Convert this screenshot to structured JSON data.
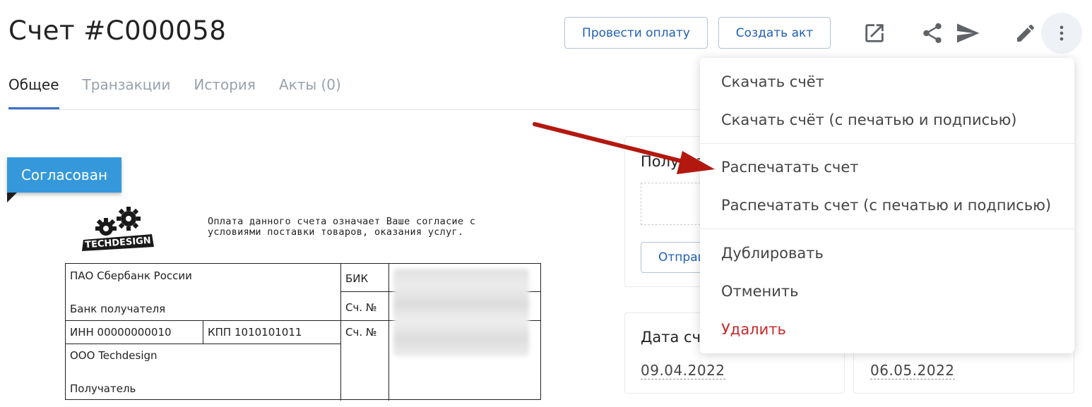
{
  "header": {
    "title": "Счет #C000058",
    "pay_button": "Провести оплату",
    "act_button": "Создать акт"
  },
  "tabs": [
    {
      "label": "Общее",
      "active": true
    },
    {
      "label": "Транзакции",
      "active": false
    },
    {
      "label": "История",
      "active": false
    },
    {
      "label": "Акты (0)",
      "active": false
    }
  ],
  "status": {
    "label": "Согласован",
    "color": "#3498db"
  },
  "logo": {
    "text": "TECHDESIGN"
  },
  "notice": {
    "line1": "Оплата данного счета означает Ваше согласие с",
    "line2": "условиями поставки товаров, оказания услуг."
  },
  "bank": {
    "bank_name": "ПАО Сбербанк России",
    "bank_label": "Банк получателя",
    "bik_label": "БИК",
    "account_label_1": "Сч. №",
    "account_label_2": "Сч. №",
    "inn": "ИНН 00000000010",
    "kpp": "КПП 1010101011",
    "recipient_name": "ООО Techdesign",
    "recipient_label": "Получатель"
  },
  "cards": {
    "card1_title": "Получатель",
    "send_button": "Отправить",
    "invoice_date_title": "Дата счета",
    "invoice_date": "09.04.2022",
    "due_date": "06.05.2022"
  },
  "menu": {
    "items": [
      {
        "label": "Скачать счёт"
      },
      {
        "label": "Скачать счёт (с печатью и подписью)"
      },
      {
        "label": "Распечатать счет"
      },
      {
        "label": "Распечатать счет (с печатью и подписью)"
      },
      {
        "label": "Дублировать"
      },
      {
        "label": "Отменить"
      },
      {
        "label": "Удалить"
      }
    ]
  },
  "icons": {
    "open": "open-in-new-icon",
    "share": "share-icon",
    "send": "send-icon",
    "edit": "pencil-icon",
    "more": "more-vertical-icon"
  },
  "colors": {
    "accent": "#1f5fb3",
    "tab_underline": "#3b6fc7",
    "danger": "#c62828",
    "annotation_arrow": "#b3180f"
  }
}
